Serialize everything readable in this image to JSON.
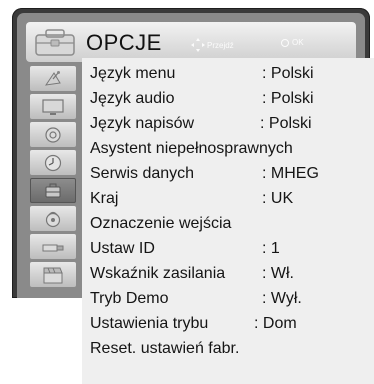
{
  "header": {
    "title": "OPCJE",
    "hint_move": "Przejdź",
    "hint_ok": "OK"
  },
  "categories": [
    {
      "icon": "satellite-dish-icon"
    },
    {
      "icon": "monitor-icon"
    },
    {
      "icon": "speaker-icon"
    },
    {
      "icon": "clock-icon"
    },
    {
      "icon": "lock-icon"
    },
    {
      "icon": "globe-icon"
    },
    {
      "icon": "usb-plug-icon"
    },
    {
      "icon": "clapperboard-icon"
    }
  ],
  "selected_category_index": 4,
  "menu": [
    {
      "label": "Język menu",
      "value": ": Polski"
    },
    {
      "label": "Język audio",
      "value": ": Polski"
    },
    {
      "label": "Język napisów",
      "value": ": Polski"
    },
    {
      "label": "Asystent niepełnosprawnych",
      "value": ""
    },
    {
      "label": "Serwis danych",
      "value": ": MHEG"
    },
    {
      "label": "Kraj",
      "value": ": UK"
    },
    {
      "label": "Oznaczenie wejścia",
      "value": ""
    },
    {
      "label": "Ustaw ID",
      "value": ": 1"
    },
    {
      "label": "Wskaźnik zasilania",
      "value": ": Wł."
    },
    {
      "label": "Tryb Demo",
      "value": ": Wył."
    },
    {
      "label": "Ustawienia trybu",
      "value": ": Dom"
    },
    {
      "label": "Reset. ustawień fabr.",
      "value": ""
    }
  ]
}
